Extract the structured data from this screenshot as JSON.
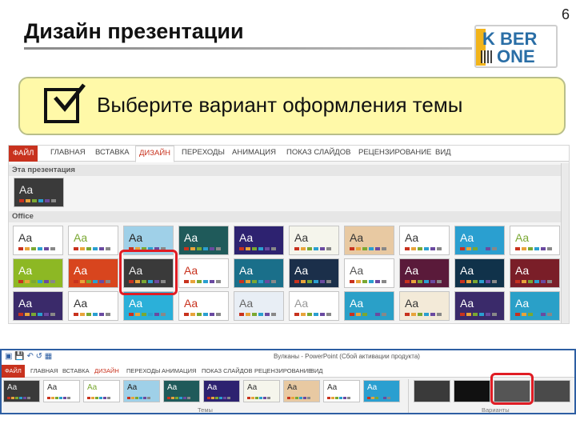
{
  "slide": {
    "number": "6",
    "title": "Дизайн презентации"
  },
  "logo": {
    "line1": "K BER",
    "line2": "ONE"
  },
  "instruction": {
    "text": "Выберите вариант оформления темы"
  },
  "ribbon_large": {
    "tabs": [
      "ФАЙЛ",
      "ГЛАВНАЯ",
      "ВСТАВКА",
      "ДИЗАЙН",
      "ПЕРЕХОДЫ",
      "АНИМАЦИЯ",
      "ПОКАЗ СЛАЙДОВ",
      "РЕЦЕНЗИРОВАНИЕ",
      "ВИД"
    ],
    "active_tab": "ДИЗАЙН",
    "section_current": "Эта презентация",
    "section_office": "Office",
    "theme_label": "Aa"
  },
  "ribbon_small": {
    "window_title": "Вулканы - PowerPoint (Сбой активации продукта)",
    "tabs": [
      "ФАЙЛ",
      "ГЛАВНАЯ",
      "ВСТАВКА",
      "ДИЗАЙН",
      "ПЕРЕХОДЫ",
      "АНИМАЦИЯ",
      "ПОКАЗ СЛАЙДОВ",
      "РЕЦЕНЗИРОВАНИЕ",
      "ВИД"
    ],
    "active_tab": "ДИЗАЙН",
    "group_themes": "Темы",
    "group_variants": "Варианты",
    "theme_label": "Aa"
  },
  "colors": {
    "accent": "#c8321e",
    "highlight": "#e01c24",
    "instruction_bg": "#fff9a8"
  }
}
